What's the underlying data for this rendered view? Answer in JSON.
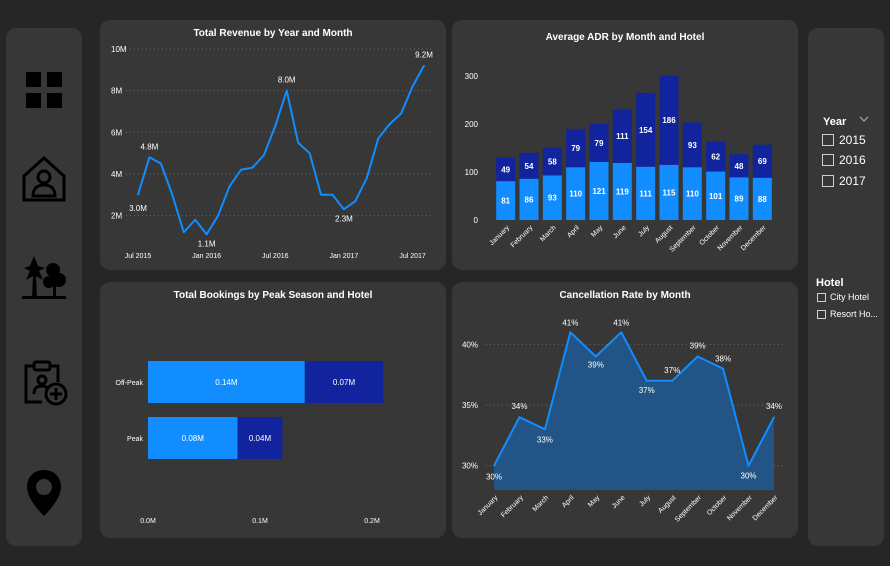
{
  "nav": {
    "items": [
      {
        "icon": "dashboard-grid-icon"
      },
      {
        "icon": "hotel-guest-icon"
      },
      {
        "icon": "resort-trees-icon"
      },
      {
        "icon": "booking-clipboard-add-icon"
      },
      {
        "icon": "location-pin-icon"
      }
    ]
  },
  "slicers": {
    "year": {
      "title": "Year",
      "options": [
        "2015",
        "2016",
        "2017"
      ]
    },
    "hotel": {
      "title": "Hotel",
      "options": [
        "City Hotel",
        "Resort Ho..."
      ]
    }
  },
  "colors": {
    "background": "#262626",
    "card": "#373737",
    "light_blue": "#118dff",
    "dark_blue": "#12239e"
  },
  "charts": {
    "revenue": {
      "title": "Total Revenue by Year and Month"
    },
    "adr": {
      "title": "Average ADR by Month and Hotel"
    },
    "bookings": {
      "title": "Total Bookings by Peak Season and Hotel"
    },
    "cancellation": {
      "title": "Cancellation Rate by Month"
    }
  },
  "chart_data": [
    {
      "type": "line",
      "title": "Total Revenue by Year and Month",
      "x_tick_labels": [
        "Jul 2015",
        "Jan 2016",
        "Jul 2016",
        "Jan 2017",
        "Jul 2017"
      ],
      "y_tick_labels": [
        "2M",
        "4M",
        "6M",
        "8M",
        "10M"
      ],
      "ylim": [
        1500000,
        10000000
      ],
      "grid": true,
      "x": [
        "Jul 2015",
        "Aug 2015",
        "Sep 2015",
        "Oct 2015",
        "Nov 2015",
        "Dec 2015",
        "Jan 2016",
        "Feb 2016",
        "Mar 2016",
        "Apr 2016",
        "May 2016",
        "Jun 2016",
        "Jul 2016",
        "Aug 2016",
        "Sep 2016",
        "Oct 2016",
        "Nov 2016",
        "Dec 2016",
        "Jan 2017",
        "Feb 2017",
        "Mar 2017",
        "Apr 2017",
        "May 2017",
        "Jun 2017",
        "Jul 2017",
        "Aug 2017"
      ],
      "values": [
        3000000,
        4800000,
        4500000,
        3000000,
        1200000,
        1800000,
        1100000,
        2000000,
        3400000,
        4200000,
        4300000,
        4900000,
        6300000,
        8000000,
        5500000,
        5000000,
        3000000,
        3000000,
        2300000,
        2700000,
        3800000,
        5700000,
        6400000,
        6900000,
        8200000,
        9200000
      ],
      "data_labels": [
        {
          "index": 0,
          "text": "3.0M"
        },
        {
          "index": 1,
          "text": "4.8M"
        },
        {
          "index": 6,
          "text": "1.1M"
        },
        {
          "index": 13,
          "text": "8.0M"
        },
        {
          "index": 18,
          "text": "2.3M"
        },
        {
          "index": 25,
          "text": "9.2M"
        }
      ],
      "color": "#118dff"
    },
    {
      "type": "bar",
      "stacked": true,
      "title": "Average ADR by Month and Hotel",
      "categories": [
        "January",
        "February",
        "March",
        "April",
        "May",
        "June",
        "July",
        "August",
        "September",
        "October",
        "November",
        "December"
      ],
      "y_tick_labels": [
        "0",
        "100",
        "200",
        "300"
      ],
      "ylim": [
        0,
        300
      ],
      "series": [
        {
          "values": [
            81,
            86,
            93,
            110,
            121,
            119,
            111,
            115,
            110,
            101,
            89,
            88
          ],
          "color": "#118dff"
        },
        {
          "values": [
            49,
            54,
            58,
            79,
            79,
            111,
            154,
            186,
            93,
            62,
            48,
            69
          ],
          "color": "#12239e"
        }
      ]
    },
    {
      "type": "bar",
      "orientation": "horizontal",
      "stacked": true,
      "title": "Total Bookings by Peak Season and Hotel",
      "categories": [
        "Off-Peak",
        "Peak"
      ],
      "x_tick_labels": [
        "0.0M",
        "0.1M",
        "0.2M"
      ],
      "xlim": [
        0,
        200000
      ],
      "series": [
        {
          "values": [
            140000,
            80000
          ],
          "labels": [
            "0.14M",
            "0.08M"
          ],
          "color": "#118dff"
        },
        {
          "values": [
            70000,
            40000
          ],
          "labels": [
            "0.07M",
            "0.04M"
          ],
          "color": "#12239e"
        }
      ]
    },
    {
      "type": "area",
      "title": "Cancellation Rate by Month",
      "categories": [
        "January",
        "February",
        "March",
        "April",
        "May",
        "June",
        "July",
        "August",
        "September",
        "October",
        "November",
        "December"
      ],
      "values": [
        30,
        34,
        33,
        41,
        39,
        41,
        37,
        37,
        39,
        38,
        30,
        34
      ],
      "y_tick_labels": [
        "30%",
        "35%",
        "40%"
      ],
      "ylim": [
        28,
        43
      ],
      "grid": true,
      "color": "#118dff"
    }
  ]
}
